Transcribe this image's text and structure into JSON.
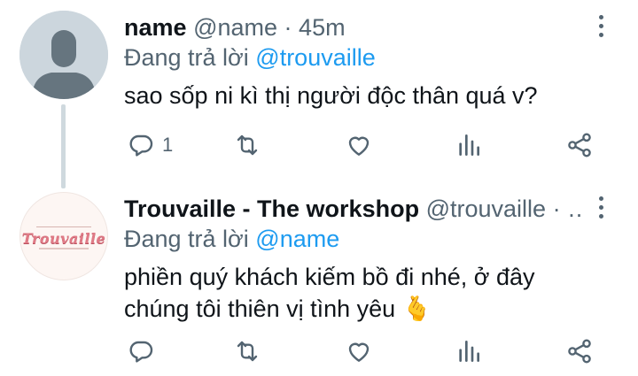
{
  "tweets": [
    {
      "display_name": "name",
      "handle": "@name",
      "separator": "·",
      "time": "45m",
      "reply_prefix": "Đang trả lời",
      "reply_to": "@trouvaille",
      "text": "sao sốp ni kì thị người độc thân quá v?",
      "reply_count": "1",
      "avatar": "default-avatar-icon"
    },
    {
      "display_name": "Trouvaille - The workshop",
      "handle": "@trouvaille",
      "separator": "· …",
      "reply_prefix": "Đang trả lời",
      "reply_to": "@name",
      "text_line1": "phiền quý khách kiếm bồ đi nhé, ở đây",
      "text_line2": "chúng tôi thiên vị tình yêu",
      "emoji": "🫰",
      "avatar_logo_text": "Trouvaille"
    }
  ],
  "icons": {
    "reply": "reply-icon",
    "retweet": "retweet-icon",
    "like": "like-icon",
    "stats": "stats-icon",
    "share": "share-icon",
    "more": "more-icon"
  },
  "colors": {
    "text": "#0f1419",
    "secondary": "#536471",
    "accent": "#1d9bf0",
    "thread_line": "#cfd9de"
  }
}
